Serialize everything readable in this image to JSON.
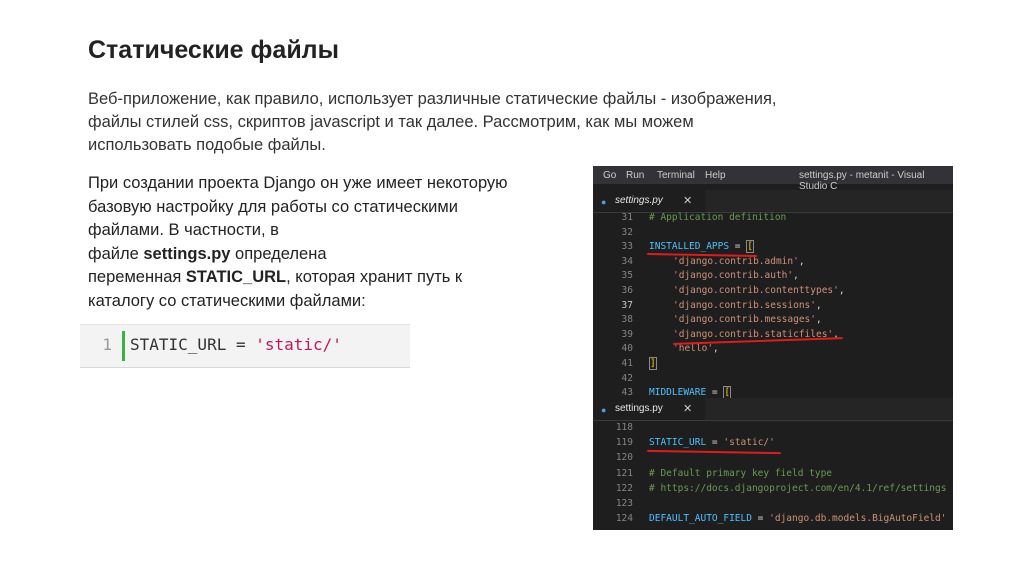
{
  "slide": {
    "title": "Статические файлы",
    "intro": [
      "Веб-приложение, как правило, использует различные статические файлы - изображения,",
      "файлы стилей css, скриптов javascript и так далее. Рассмотрим, как мы можем",
      "использовать подобые файлы."
    ],
    "body": {
      "line1": "При создании проекта Django он уже имеет некоторую",
      "line2": "базовую настройку для работы со статическими",
      "line3": "файлами. В частности, в",
      "line4_pre": "файле ",
      "line4_bold": "settings.py",
      "line4_post": " определена",
      "line5_pre": "переменная ",
      "line5_bold": "STATIC_URL",
      "line5_post": ", которая хранит путь к",
      "line6": "каталогу со статическими файлами:"
    },
    "snippet": {
      "line_number": "1",
      "code_prefix": "STATIC_URL = ",
      "code_string": "'static/'"
    }
  },
  "vscode": {
    "menu": [
      "Go",
      "Run",
      "Terminal",
      "Help"
    ],
    "window_title": "settings.py - metanit - Visual Studio C",
    "tab1": "settings.py",
    "tab2": "settings.py",
    "tab_close": "✕",
    "tab_dot": "●",
    "block1": [
      {
        "n": "31",
        "code": "# Application definition"
      },
      {
        "n": "32",
        "code": ""
      },
      {
        "n": "33",
        "code": "INSTALLED_APPS = ["
      },
      {
        "n": "34",
        "code": "'django.contrib.admin',"
      },
      {
        "n": "35",
        "code": "'django.contrib.auth',"
      },
      {
        "n": "36",
        "code": "'django.contrib.contenttypes',"
      },
      {
        "n": "37",
        "code": "'django.contrib.sessions',"
      },
      {
        "n": "38",
        "code": "'django.contrib.messages',"
      },
      {
        "n": "39",
        "code": "'django.contrib.staticfiles',"
      },
      {
        "n": "40",
        "code": "'hello',"
      },
      {
        "n": "41",
        "code": "]"
      },
      {
        "n": "42",
        "code": ""
      },
      {
        "n": "43",
        "code": "MIDDLEWARE = ["
      }
    ],
    "block2": [
      {
        "n": "118",
        "code": ""
      },
      {
        "n": "119",
        "code": "STATIC_URL = 'static/'"
      },
      {
        "n": "120",
        "code": ""
      },
      {
        "n": "121",
        "code": "# Default primary key field type"
      },
      {
        "n": "122",
        "code": "# https://docs.djangoproject.com/en/4.1/ref/settings"
      },
      {
        "n": "123",
        "code": ""
      },
      {
        "n": "124",
        "code": "DEFAULT_AUTO_FIELD = 'django.db.models.BigAutoField'"
      }
    ]
  }
}
